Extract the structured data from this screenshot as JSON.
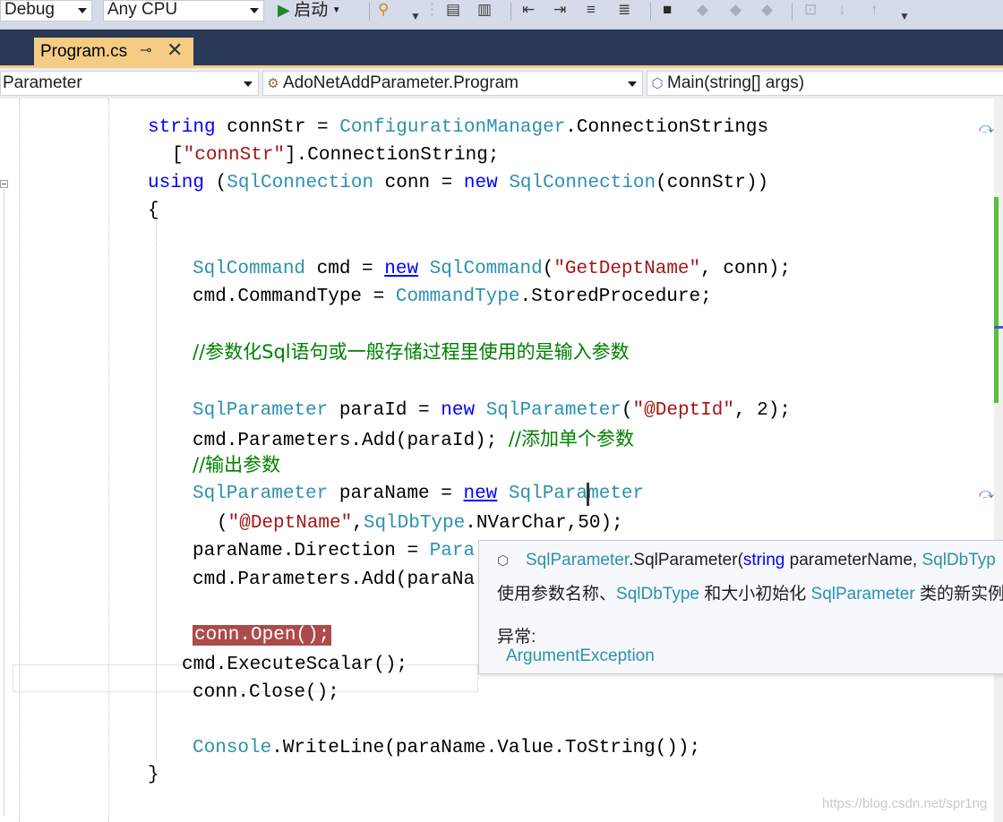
{
  "toolbar": {
    "config": "Debug",
    "platform": "Any CPU",
    "start_label": "启动"
  },
  "tab": {
    "title": "Program.cs",
    "pin_icon": "pin-icon",
    "close_icon": "close-icon"
  },
  "nav": {
    "project": "Parameter",
    "class": "AdoNetAddParameter.Program",
    "member": "Main(string[] args)"
  },
  "code": {
    "l1": [
      "string",
      " connStr = ",
      "ConfigurationManager",
      ".ConnectionStrings"
    ],
    "l2": [
      "[",
      "\"connStr\"",
      "].ConnectionString;"
    ],
    "l3": [
      "using",
      " (",
      "SqlConnection",
      " conn = ",
      "new",
      " ",
      "SqlConnection",
      "(connStr))"
    ],
    "l4": "{",
    "l5": [
      "SqlCommand",
      " cmd = ",
      "new",
      " ",
      "SqlCommand",
      "(",
      "\"GetDeptName\"",
      ", conn);"
    ],
    "l6": [
      "cmd.CommandType = ",
      "CommandType",
      ".StoredProcedure;"
    ],
    "l7": "//参数化Sql语句或一般存储过程里使用的是输入参数",
    "l8": [
      "SqlParameter",
      " paraId = ",
      "new",
      " ",
      "SqlParameter",
      "(",
      "\"@DeptId\"",
      ", 2);"
    ],
    "l9": [
      "cmd.Parameters.Add(paraId); ",
      "//添加单个参数"
    ],
    "l10": "//输出参数",
    "l11": [
      "SqlParameter",
      " paraName = ",
      "new",
      " ",
      "SqlPara",
      "meter"
    ],
    "l12": [
      "(",
      "\"@DeptName\"",
      ",",
      "SqlDbType",
      ".NVarChar,50);"
    ],
    "l13": [
      "paraName.Direction = ",
      "Para"
    ],
    "l14": "cmd.Parameters.Add(paraNa",
    "l15": "conn.Open();",
    "l16": "cmd.ExecuteScalar();",
    "l17": "conn.Close();",
    "l18": [
      "Console",
      ".WriteLine(paraName.Value.ToString());"
    ],
    "l19": "}"
  },
  "tooltip": {
    "sig_type": "SqlParameter",
    "sig_method": ".SqlParameter(",
    "sig_kw": "string",
    "sig_param": " parameterName, ",
    "sig_type2": "SqlDbTyp",
    "desc_1": "使用参数名称、",
    "desc_type1": "SqlDbType",
    "desc_2": " 和大小初始化 ",
    "desc_type2": "SqlParameter",
    "desc_3": " 类的新实例",
    "exc_label": "异常:",
    "exc_item": "ArgumentException"
  },
  "watermark": "https://blog.csdn.net/spr1ng",
  "colors": {
    "keyword": "#0000ff",
    "type": "#2b91af",
    "string": "#a31515",
    "comment": "#008000",
    "breakpoint": "#ae4a4a",
    "tab_active": "#f5cc84",
    "tab_strip": "#293955"
  }
}
